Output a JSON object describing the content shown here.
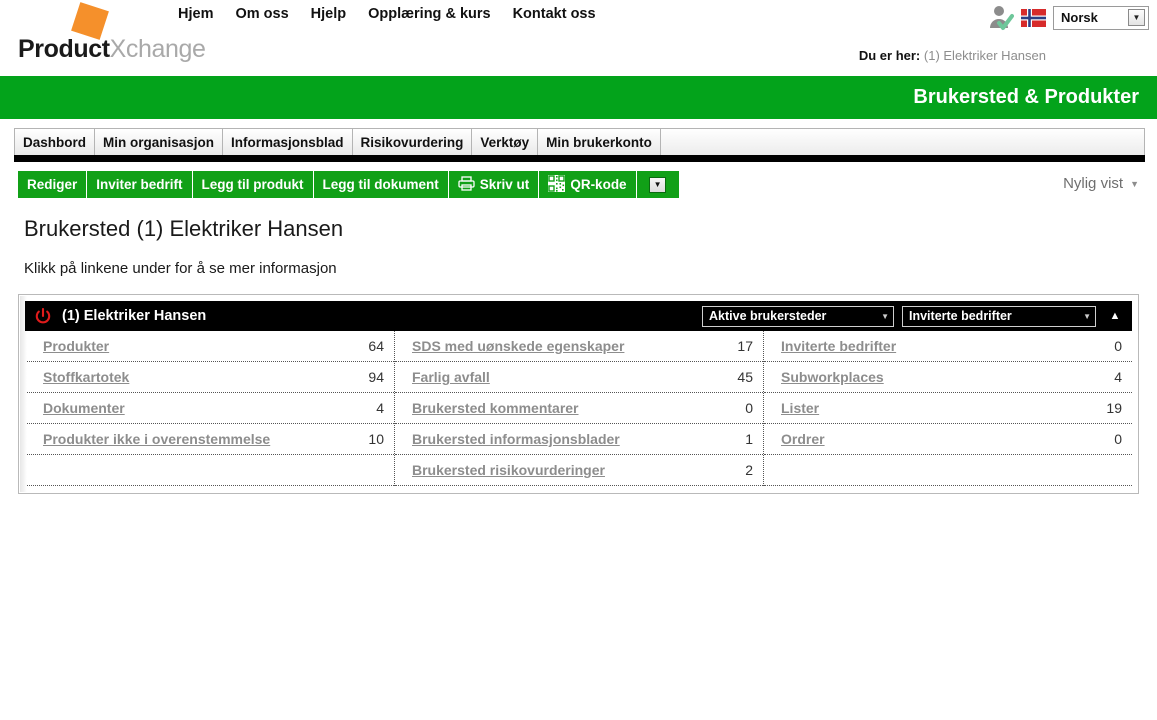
{
  "brand": {
    "name_bold": "Product",
    "name_light": "Xchange",
    "logo_icon": "orange-square-logo"
  },
  "mainnav": {
    "items": [
      {
        "label": "Hjem"
      },
      {
        "label": "Om oss"
      },
      {
        "label": "Hjelp"
      },
      {
        "label": "Opplæring & kurs"
      },
      {
        "label": "Kontakt oss"
      }
    ]
  },
  "topright": {
    "user_icon": "user-verified-icon",
    "flag_icon": "norway-flag-icon",
    "language": {
      "value": "Norsk",
      "caret": "▼"
    }
  },
  "breadcrumb": {
    "label": "Du er her:",
    "value": "(1) Elektriker Hansen"
  },
  "banner": {
    "title": "Brukersted & Produkter",
    "color": "#03a31b"
  },
  "tabs": [
    {
      "label": "Dashbord"
    },
    {
      "label": "Min organisasjon"
    },
    {
      "label": "Informasjonsblad"
    },
    {
      "label": "Risikovurdering"
    },
    {
      "label": "Verktøy"
    },
    {
      "label": "Min brukerkonto"
    }
  ],
  "toolbar": {
    "buttons": [
      {
        "label": "Rediger",
        "icon": ""
      },
      {
        "label": "Inviter bedrift",
        "icon": ""
      },
      {
        "label": "Legg til produkt",
        "icon": ""
      },
      {
        "label": "Legg til dokument",
        "icon": ""
      },
      {
        "label": "Skriv ut",
        "icon": "printer-icon"
      },
      {
        "label": "QR-kode",
        "icon": "qr-code-icon"
      }
    ],
    "caret": "▼",
    "recent": {
      "label": "Nylig vist",
      "caret": "▼"
    }
  },
  "page": {
    "title": "Brukersted (1) Elektriker Hansen",
    "subtitle": "Klikk på linkene under for å se mer informasjon"
  },
  "panel": {
    "header": {
      "icon": "power-refresh-icon",
      "title": "(1) Elektriker Hansen",
      "select_workplaces": {
        "value": "Aktive brukersteder",
        "caret": "▼"
      },
      "select_companies": {
        "value": "Inviterte bedrifter",
        "caret": "▼"
      },
      "collapse_icon": "▲"
    },
    "columns": [
      {
        "rows": [
          {
            "label": "Produkter",
            "value": "64"
          },
          {
            "label": "Stoffkartotek",
            "value": "94"
          },
          {
            "label": "Dokumenter",
            "value": "4"
          },
          {
            "label": "Produkter ikke i overenstemmelse",
            "value": "10"
          },
          {
            "label": "",
            "value": "",
            "empty": true
          }
        ]
      },
      {
        "rows": [
          {
            "label": "SDS med uønskede egenskaper",
            "value": "17"
          },
          {
            "label": "Farlig avfall",
            "value": "45"
          },
          {
            "label": "Brukersted kommentarer",
            "value": "0"
          },
          {
            "label": "Brukersted informasjonsblader",
            "value": "1"
          },
          {
            "label": "Brukersted risikovurderinger",
            "value": "2"
          }
        ]
      },
      {
        "rows": [
          {
            "label": "Inviterte bedrifter",
            "value": "0"
          },
          {
            "label": "Subworkplaces",
            "value": "4"
          },
          {
            "label": "Lister",
            "value": "19"
          },
          {
            "label": "Ordrer",
            "value": "0"
          },
          {
            "label": "",
            "value": "",
            "empty": true
          }
        ]
      }
    ]
  }
}
